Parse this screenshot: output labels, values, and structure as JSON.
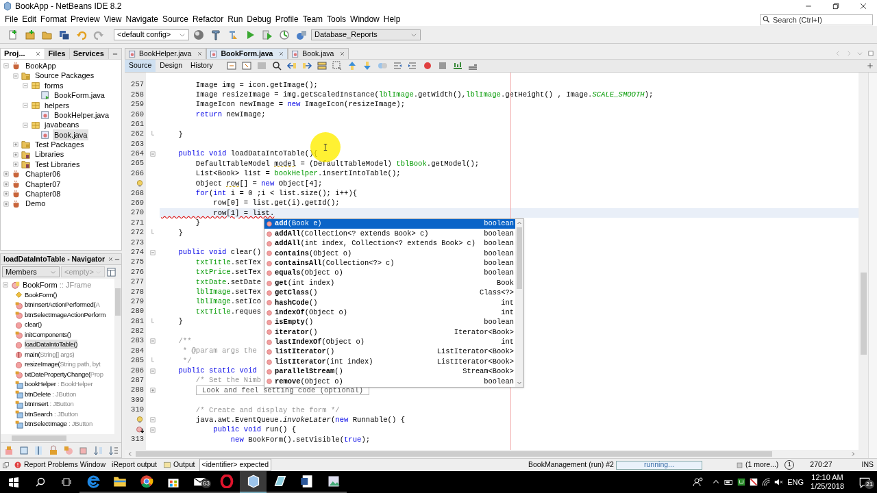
{
  "window": {
    "title": "BookApp - NetBeans IDE 8.2",
    "search_placeholder": "Search (Ctrl+I)"
  },
  "menu": [
    "File",
    "Edit",
    "Format",
    "Preview",
    "View",
    "Navigate",
    "Source",
    "Refactor",
    "Run",
    "Debug",
    "Profile",
    "Team",
    "Tools",
    "Window",
    "Help"
  ],
  "toolbar": {
    "config": "<default config>",
    "project": "Database_Reports"
  },
  "projects_panel": {
    "tabs": [
      {
        "label": "Proj...",
        "selected": true,
        "closable": true
      },
      {
        "label": "Files",
        "selected": false,
        "closable": false
      },
      {
        "label": "Services",
        "selected": false,
        "closable": false
      }
    ],
    "tree": [
      {
        "label": "BookApp",
        "kind": "project",
        "expanded": true,
        "selected": false,
        "children": [
          {
            "label": "Source Packages",
            "kind": "source",
            "expanded": true,
            "selected": false,
            "children": [
              {
                "label": "forms",
                "kind": "package",
                "expanded": true,
                "selected": false,
                "children": [
                  {
                    "label": "BookForm.java",
                    "kind": "form",
                    "selected": false
                  }
                ]
              },
              {
                "label": "helpers",
                "kind": "package",
                "expanded": true,
                "selected": false,
                "children": [
                  {
                    "label": "BookHelper.java",
                    "kind": "java",
                    "selected": false
                  }
                ]
              },
              {
                "label": "javabeans",
                "kind": "package",
                "expanded": true,
                "selected": false,
                "children": [
                  {
                    "label": "Book.java",
                    "kind": "java",
                    "selected": true
                  }
                ]
              }
            ]
          },
          {
            "label": "Test Packages",
            "kind": "source",
            "expanded": false,
            "selected": false
          },
          {
            "label": "Libraries",
            "kind": "library",
            "expanded": false,
            "selected": false
          },
          {
            "label": "Test Libraries",
            "kind": "library",
            "expanded": false,
            "selected": false
          }
        ]
      },
      {
        "label": "Chapter06",
        "kind": "project",
        "expanded": false,
        "selected": false
      },
      {
        "label": "Chapter07",
        "kind": "project",
        "expanded": false,
        "selected": false
      },
      {
        "label": "Chapter08",
        "kind": "project",
        "expanded": false,
        "selected": false
      },
      {
        "label": "Demo",
        "kind": "project",
        "expanded": false,
        "selected": false
      }
    ]
  },
  "navigator": {
    "title": "loadDataIntoTable - Navigator",
    "filter": "Members",
    "scope": "<empty>",
    "root": {
      "name": "BookForm",
      "detail": " :: JFrame"
    },
    "members": [
      {
        "name": "BookForm()",
        "kind": "constructor",
        "selected": false
      },
      {
        "name": "btnInsertActionPerformed(",
        "detail": "A",
        "kind": "private_method",
        "selected": false
      },
      {
        "name": "btnSelectImageActionPerform",
        "kind": "private_method",
        "selected": false
      },
      {
        "name": "clear()",
        "kind": "method",
        "selected": false
      },
      {
        "name": "initComponents()",
        "kind": "private_method",
        "selected": false
      },
      {
        "name": "loadDataIntoTable()",
        "kind": "method",
        "selected": true
      },
      {
        "name": "main(",
        "detail": "String[] args)",
        "kind": "static_method",
        "selected": false
      },
      {
        "name": "resizeImage(",
        "detail": "String path, byt",
        "kind": "method",
        "selected": false
      },
      {
        "name": "txtDatePropertyChange(",
        "detail": "Prop",
        "kind": "private_method",
        "selected": false
      },
      {
        "name": "bookHelper",
        "detail": " : BookHelper",
        "kind": "field",
        "selected": false
      },
      {
        "name": "btnDelete",
        "detail": " : JButton",
        "kind": "field",
        "selected": false
      },
      {
        "name": "btnInsert",
        "detail": " : JButton",
        "kind": "field",
        "selected": false
      },
      {
        "name": "btnSearch",
        "detail": " : JButton",
        "kind": "field",
        "selected": false
      },
      {
        "name": "btnSelectImage",
        "detail": " : JButton",
        "kind": "field",
        "selected": false
      }
    ]
  },
  "editor": {
    "tabs": [
      {
        "label": "BookHelper.java",
        "selected": false
      },
      {
        "label": "BookForm.java",
        "selected": true
      },
      {
        "label": "Book.java",
        "selected": false
      }
    ],
    "views": [
      {
        "label": "Source",
        "selected": true
      },
      {
        "label": "Design",
        "selected": false
      },
      {
        "label": "History",
        "selected": false
      }
    ],
    "lines": [
      {
        "number": "257",
        "current": false,
        "segments": [
          {
            "text": "        Image img = icon.getImage();",
            "kind": "plain"
          }
        ]
      },
      {
        "number": "258",
        "current": false,
        "segments": [
          {
            "text": "        Image resizeImage = img.getScaledInstance(",
            "kind": "plain"
          },
          {
            "text": "lblImage",
            "kind": "field"
          },
          {
            "text": ".getWidth(),",
            "kind": "plain"
          },
          {
            "text": "lblImage",
            "kind": "field"
          },
          {
            "text": ".getHeight() , Image.",
            "kind": "plain"
          },
          {
            "text": "SCALE_SMOOTH",
            "kind": "static_field"
          },
          {
            "text": ");",
            "kind": "plain"
          }
        ]
      },
      {
        "number": "259",
        "current": false,
        "segments": [
          {
            "text": "        ImageIcon newImage = ",
            "kind": "plain"
          },
          {
            "text": "new",
            "kind": "keyword"
          },
          {
            "text": " ImageIcon(resizeImage);",
            "kind": "plain"
          }
        ]
      },
      {
        "number": "260",
        "current": false,
        "segments": [
          {
            "text": "        return",
            "kind": "keyword"
          },
          {
            "text": " newImage;",
            "kind": "plain"
          }
        ]
      },
      {
        "number": "261",
        "current": false
      },
      {
        "number": "262",
        "current": false,
        "fold": {
          "kind": "end"
        },
        "segments": [
          {
            "text": "    }",
            "kind": "plain"
          }
        ]
      },
      {
        "number": "263",
        "current": false
      },
      {
        "number": "264",
        "current": false,
        "fold": {
          "kind": "open"
        },
        "segments": [
          {
            "text": "    public void",
            "kind": "keyword"
          },
          {
            "text": " loadDataIntoTable(){",
            "kind": "plain"
          }
        ]
      },
      {
        "number": "265",
        "current": false,
        "segments": [
          {
            "text": "        DefaultTableModel ",
            "kind": "plain"
          },
          {
            "text": "model",
            "kind": "unused"
          },
          {
            "text": " = (DefaultTableModel) ",
            "kind": "plain"
          },
          {
            "text": "tblBook",
            "kind": "field"
          },
          {
            "text": ".getModel();",
            "kind": "plain"
          }
        ]
      },
      {
        "number": "266",
        "current": false,
        "segments": [
          {
            "text": "        List<Book> list = ",
            "kind": "plain"
          },
          {
            "text": "bookHelper",
            "kind": "field"
          },
          {
            "text": ".insertIntoTable();",
            "kind": "plain"
          }
        ]
      },
      {
        "gutter_icon": {
          "kind": "hint"
        },
        "current": false,
        "segments": [
          {
            "text": "        Object ",
            "kind": "plain"
          },
          {
            "text": "row",
            "kind": "unused"
          },
          {
            "text": "[] = ",
            "kind": "plain"
          },
          {
            "text": "new",
            "kind": "keyword"
          },
          {
            "text": " Object[4];",
            "kind": "plain"
          }
        ]
      },
      {
        "number": "268",
        "current": false,
        "segments": [
          {
            "text": "        for",
            "kind": "keyword"
          },
          {
            "text": "(",
            "kind": "plain"
          },
          {
            "text": "int",
            "kind": "keyword"
          },
          {
            "text": " i = 0 ;i < list.size(); i++){",
            "kind": "plain"
          }
        ]
      },
      {
        "number": "269",
        "current": false,
        "segments": [
          {
            "text": "            row[0] = list.get(i).getId();",
            "kind": "plain"
          }
        ]
      },
      {
        "number": "270",
        "current": true,
        "segments": [
          {
            "text": "            row[1] = list.",
            "kind": "error"
          }
        ]
      },
      {
        "number": "271",
        "current": false,
        "segments": [
          {
            "text": "        }",
            "kind": "plain"
          }
        ]
      },
      {
        "number": "272",
        "current": false,
        "fold": {
          "kind": "end"
        },
        "segments": [
          {
            "text": "    }",
            "kind": "plain"
          }
        ]
      },
      {
        "number": "273",
        "current": false
      },
      {
        "number": "274",
        "current": false,
        "fold": {
          "kind": "open"
        },
        "segments": [
          {
            "text": "    public void",
            "kind": "keyword"
          },
          {
            "text": " clear()",
            "kind": "plain"
          }
        ]
      },
      {
        "number": "275",
        "current": false,
        "segments": [
          {
            "text": "        txtTitle",
            "kind": "field"
          },
          {
            "text": ".setTex",
            "kind": "plain"
          }
        ]
      },
      {
        "number": "276",
        "current": false,
        "segments": [
          {
            "text": "        txtPrice",
            "kind": "field"
          },
          {
            "text": ".setTex",
            "kind": "plain"
          }
        ]
      },
      {
        "number": "277",
        "current": false,
        "segments": [
          {
            "text": "        txtDate",
            "kind": "field"
          },
          {
            "text": ".setDate",
            "kind": "plain"
          }
        ]
      },
      {
        "number": "278",
        "current": false,
        "segments": [
          {
            "text": "        lblImage",
            "kind": "field"
          },
          {
            "text": ".setTex",
            "kind": "plain"
          }
        ]
      },
      {
        "number": "279",
        "current": false,
        "segments": [
          {
            "text": "        lblImage",
            "kind": "field"
          },
          {
            "text": ".setIco",
            "kind": "plain"
          }
        ]
      },
      {
        "number": "280",
        "current": false,
        "segments": [
          {
            "text": "        txtTitle",
            "kind": "field"
          },
          {
            "text": ".reques",
            "kind": "plain"
          }
        ]
      },
      {
        "number": "281",
        "current": false,
        "fold": {
          "kind": "end"
        },
        "segments": [
          {
            "text": "    }",
            "kind": "plain"
          }
        ]
      },
      {
        "number": "282",
        "current": false
      },
      {
        "number": "283",
        "current": false,
        "fold": {
          "kind": "open"
        },
        "segments": [
          {
            "text": "    /**",
            "kind": "comment"
          }
        ]
      },
      {
        "number": "284",
        "current": false,
        "segments": [
          {
            "text": "     * @param args the",
            "kind": "comment"
          }
        ]
      },
      {
        "number": "285",
        "current": false,
        "fold": {
          "kind": "end"
        },
        "segments": [
          {
            "text": "     */",
            "kind": "comment"
          }
        ]
      },
      {
        "number": "286",
        "current": false,
        "fold": {
          "kind": "open"
        },
        "segments": [
          {
            "text": "    public static void",
            "kind": "keyword"
          }
        ]
      },
      {
        "number": "287",
        "current": false,
        "segments": [
          {
            "text": "        /* Set the Nimb",
            "kind": "comment"
          }
        ]
      },
      {
        "number": "288",
        "current": false,
        "fold": {
          "kind": "collapsed"
        },
        "segments": [
          {
            "text": "Look and feel setting code (optional)",
            "kind": "folded"
          }
        ]
      },
      {
        "number": "309",
        "current": false
      },
      {
        "number": "310",
        "current": false,
        "segments": [
          {
            "text": "        /* Create and display the form */",
            "kind": "comment"
          }
        ]
      },
      {
        "gutter_icon": {
          "kind": "hint"
        },
        "current": false,
        "fold": {
          "kind": "open"
        },
        "segments": [
          {
            "text": "        java.awt.EventQueue.",
            "kind": "plain"
          },
          {
            "text": "invokeLater",
            "kind": "italic"
          },
          {
            "text": "(",
            "kind": "plain"
          },
          {
            "text": "new",
            "kind": "keyword"
          },
          {
            "text": " Runnable() {",
            "kind": "plain"
          }
        ]
      },
      {
        "gutter_icon": {
          "kind": "override"
        },
        "current": false,
        "fold": {
          "kind": "open"
        },
        "segments": [
          {
            "text": "            public void",
            "kind": "keyword"
          },
          {
            "text": " run() {",
            "kind": "plain"
          }
        ]
      },
      {
        "number": "313",
        "current": false,
        "segments": [
          {
            "text": "                new",
            "kind": "keyword"
          },
          {
            "text": " BookForm().setVisible(",
            "kind": "plain"
          },
          {
            "text": "true",
            "kind": "keyword"
          },
          {
            "text": ");",
            "kind": "plain"
          }
        ]
      }
    ],
    "completion": [
      {
        "name": "add",
        "params": "(Book e)",
        "returns": "boolean",
        "selected": true
      },
      {
        "name": "addAll",
        "params": "(Collection<? extends Book> c)",
        "returns": "boolean",
        "selected": false
      },
      {
        "name": "addAll",
        "params": "(int index, Collection<? extends Book> c)",
        "returns": "boolean",
        "selected": false
      },
      {
        "name": "contains",
        "params": "(Object o)",
        "returns": "boolean",
        "selected": false
      },
      {
        "name": "containsAll",
        "params": "(Collection<?> c)",
        "returns": "boolean",
        "selected": false
      },
      {
        "name": "equals",
        "params": "(Object o)",
        "returns": "boolean",
        "selected": false
      },
      {
        "name": "get",
        "params": "(int index)",
        "returns": "Book",
        "selected": false
      },
      {
        "name": "getClass",
        "params": "()",
        "returns": "Class<?>",
        "selected": false
      },
      {
        "name": "hashCode",
        "params": "()",
        "returns": "int",
        "selected": false
      },
      {
        "name": "indexOf",
        "params": "(Object o)",
        "returns": "int",
        "selected": false
      },
      {
        "name": "isEmpty",
        "params": "()",
        "returns": "boolean",
        "selected": false
      },
      {
        "name": "iterator",
        "params": "()",
        "returns": "Iterator<Book>",
        "selected": false
      },
      {
        "name": "lastIndexOf",
        "params": "(Object o)",
        "returns": "int",
        "selected": false
      },
      {
        "name": "listIterator",
        "params": "()",
        "returns": "ListIterator<Book>",
        "selected": false
      },
      {
        "name": "listIterator",
        "params": "(int index)",
        "returns": "ListIterator<Book>",
        "selected": false
      },
      {
        "name": "parallelStream",
        "params": "()",
        "returns": "Stream<Book>",
        "selected": false
      },
      {
        "name": "remove",
        "params": "(Object o)",
        "returns": "boolean",
        "selected": false
      }
    ]
  },
  "status_bar": {
    "windows": [
      "Report Problems Window",
      "iReport output",
      "Output"
    ],
    "message": "<identifier> expected",
    "task": "BookManagement (run) #2",
    "progress": "running...",
    "level": 1,
    "more": "(1 more...)",
    "notifications": "1",
    "position": "270:27",
    "mode": "INS"
  },
  "taskbar": {
    "mail_badge": "63",
    "language": "ENG",
    "time": "12:10 AM",
    "date": "1/25/2018",
    "action_center": "21"
  }
}
